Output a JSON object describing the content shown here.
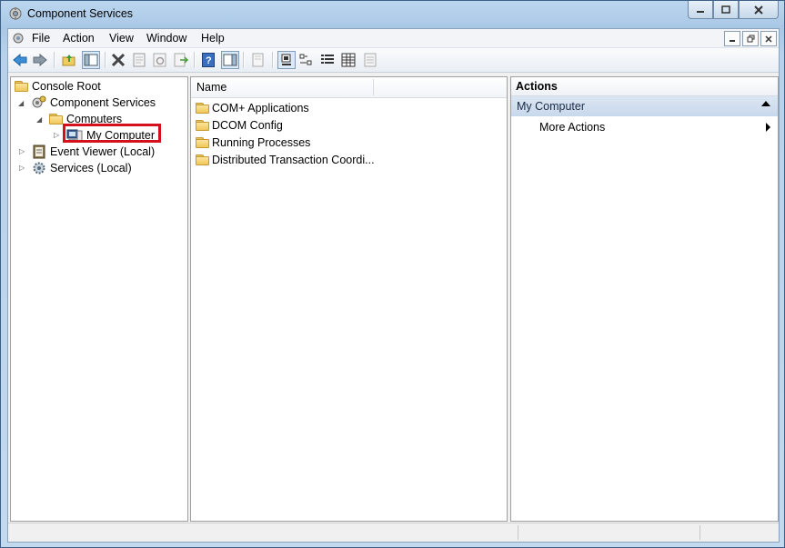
{
  "window": {
    "title": "Component Services"
  },
  "menu": {
    "items": [
      "File",
      "Action",
      "View",
      "Window",
      "Help"
    ]
  },
  "tree": {
    "nodes": [
      {
        "label": "Console Root"
      },
      {
        "label": "Component Services"
      },
      {
        "label": "Computers"
      },
      {
        "label": "My Computer",
        "highlighted": true
      },
      {
        "label": "Event Viewer (Local)"
      },
      {
        "label": "Services (Local)"
      }
    ]
  },
  "list": {
    "column_header": "Name",
    "rows": [
      {
        "label": "COM+ Applications"
      },
      {
        "label": "DCOM Config"
      },
      {
        "label": "Running Processes"
      },
      {
        "label": "Distributed Transaction Coordi..."
      }
    ]
  },
  "actions": {
    "header": "Actions",
    "section": "My Computer",
    "items": [
      {
        "label": "More Actions"
      }
    ]
  },
  "colors": {
    "highlight_box": "#d3101c",
    "section_bg": "#c8d8ec"
  },
  "icons": [
    "app-icon",
    "back-icon",
    "forward-icon",
    "up-folder-icon",
    "show-hide-tree-icon",
    "delete-icon",
    "properties-icon",
    "refresh-icon",
    "export-icon",
    "help-icon",
    "show-hide-action-pane-icon",
    "new-window-icon",
    "large-icons-view-icon",
    "small-icons-view-icon",
    "list-view-icon",
    "detail-view-icon"
  ]
}
